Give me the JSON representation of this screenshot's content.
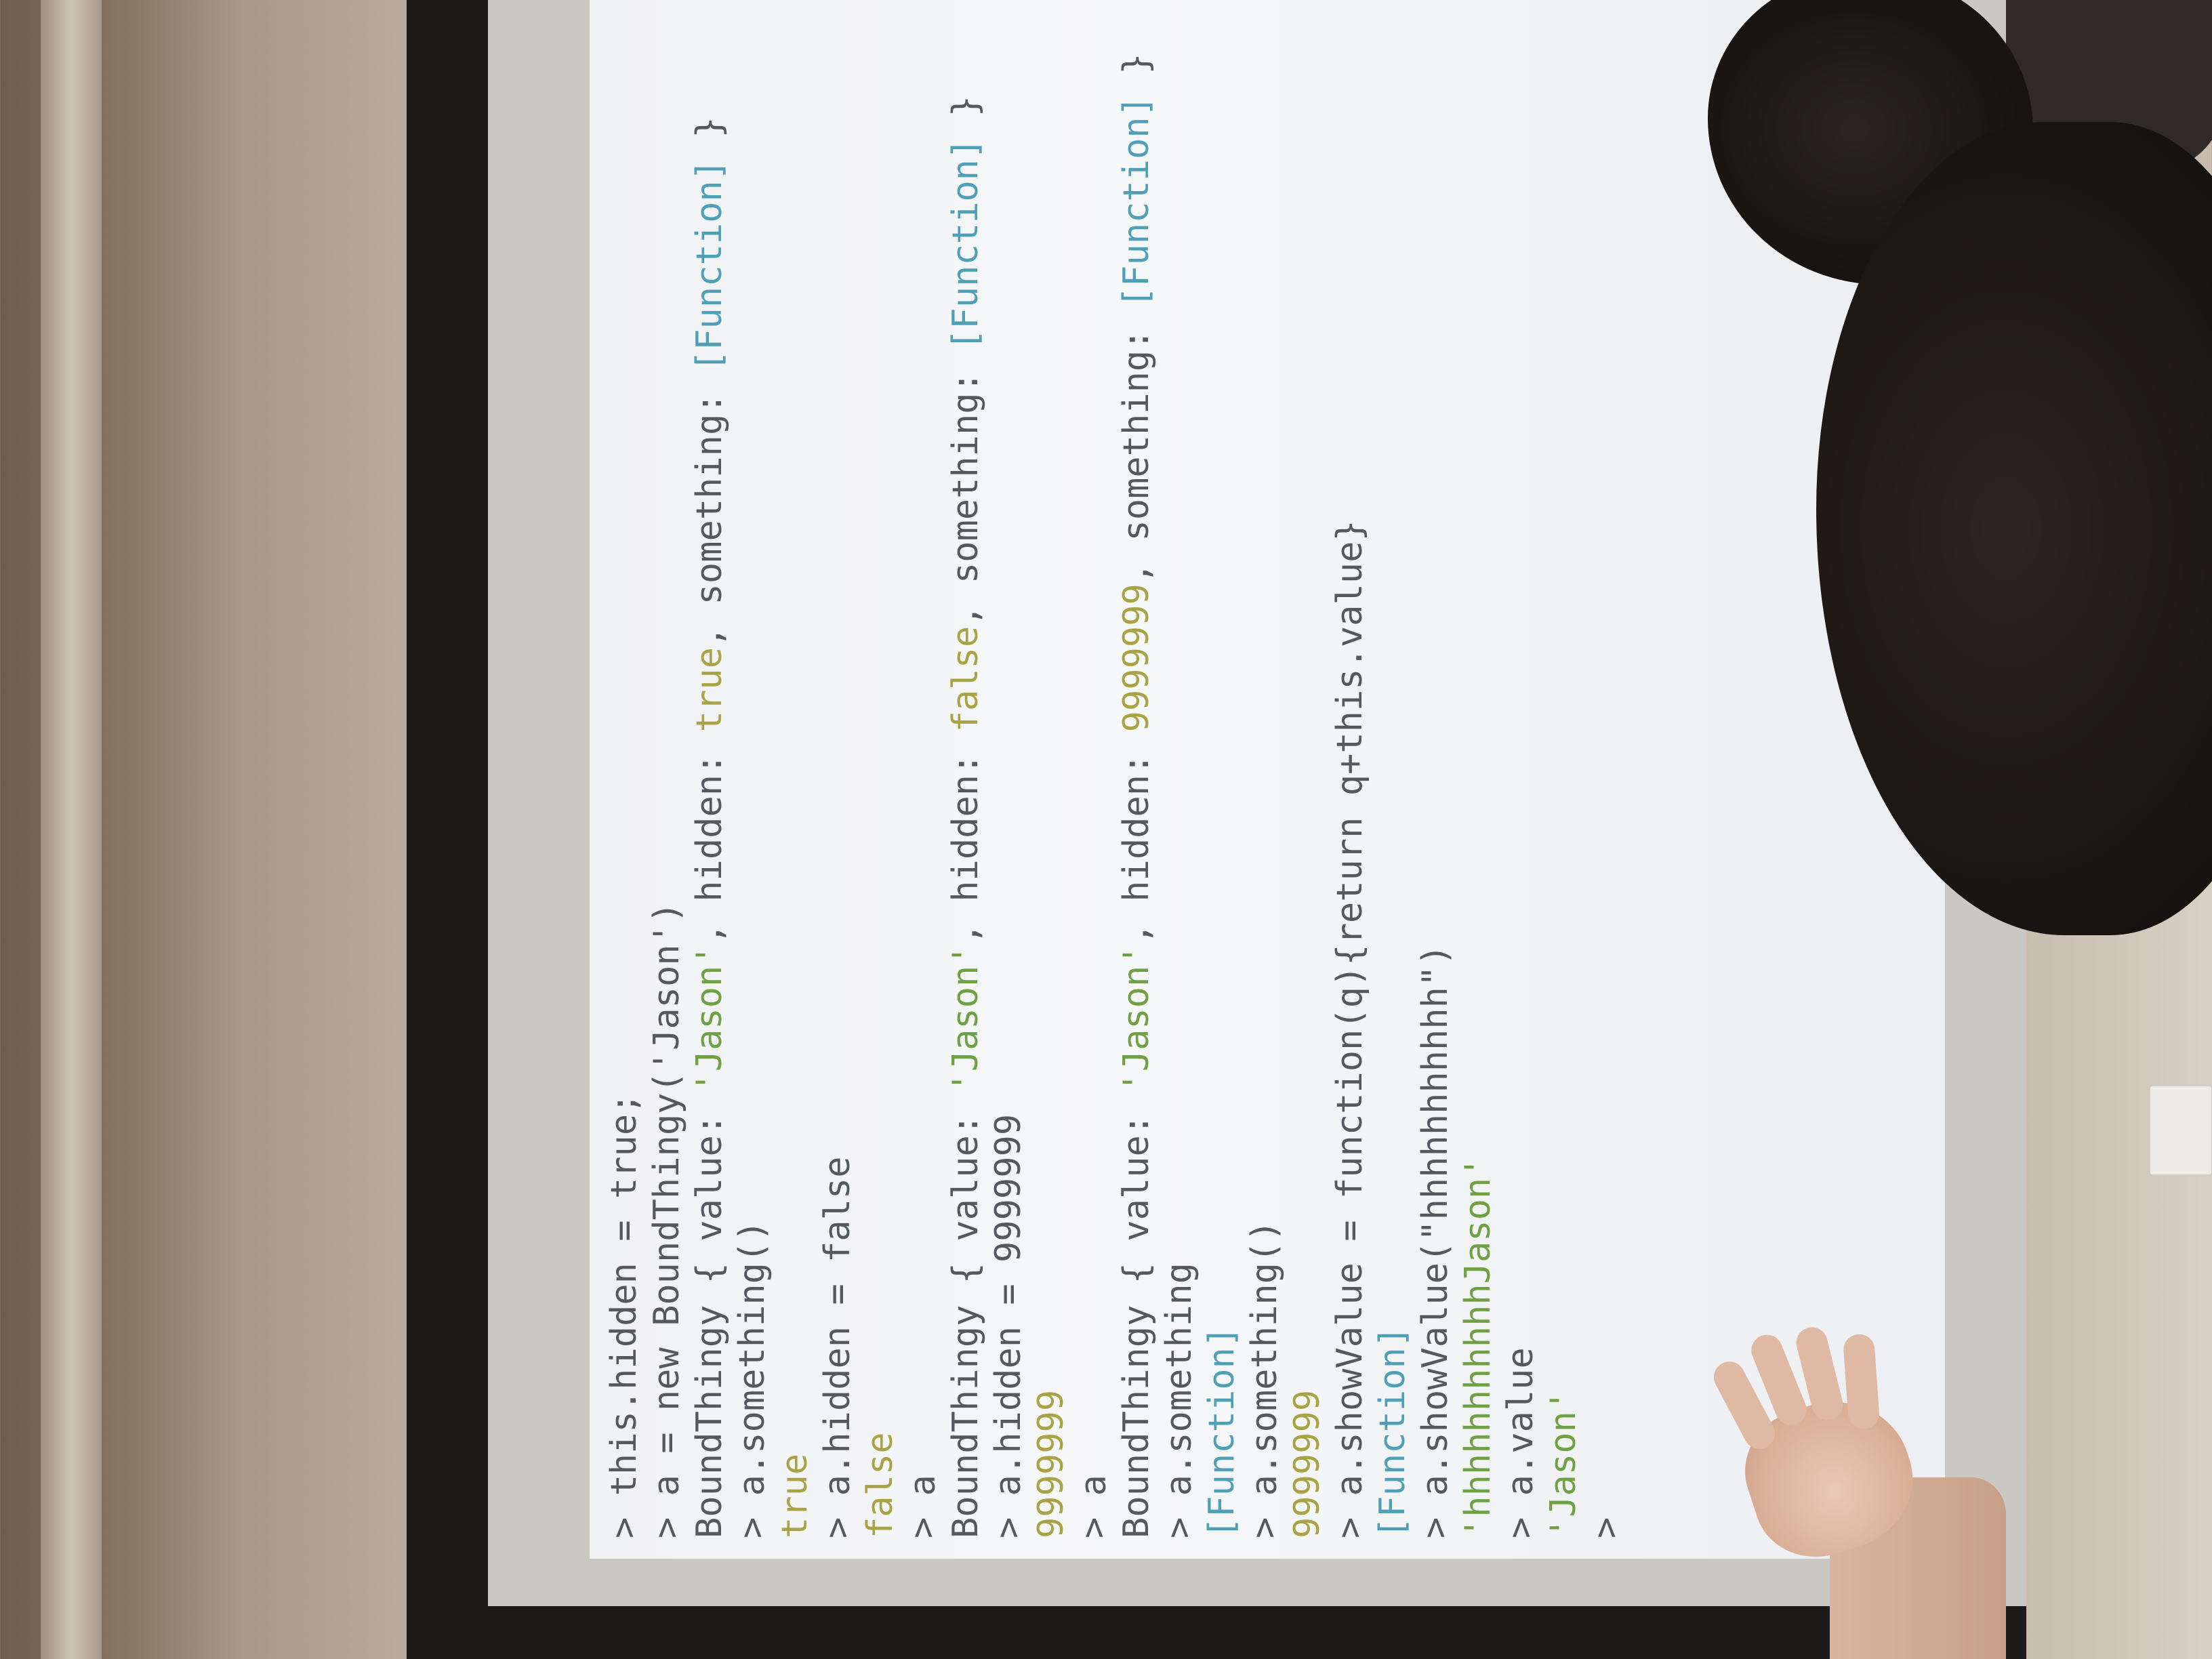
{
  "terminal": {
    "lines": [
      [
        {
          "t": "> this.hidden = true;",
          "c": "plain"
        }
      ],
      [
        {
          "t": "> a = new BoundThingy('Jason')",
          "c": "plain"
        }
      ],
      [
        {
          "t": "BoundThingy { value: ",
          "c": "plain"
        },
        {
          "t": "'Jason'",
          "c": "str"
        },
        {
          "t": ", hidden: ",
          "c": "plain"
        },
        {
          "t": "true",
          "c": "bool"
        },
        {
          "t": ", something: ",
          "c": "plain"
        },
        {
          "t": "[Function]",
          "c": "fn"
        },
        {
          "t": " }",
          "c": "plain"
        }
      ],
      [
        {
          "t": "> a.something()",
          "c": "plain"
        }
      ],
      [
        {
          "t": "true",
          "c": "bool"
        }
      ],
      [
        {
          "t": "> a.hidden = false",
          "c": "plain"
        }
      ],
      [
        {
          "t": "false",
          "c": "bool"
        }
      ],
      [
        {
          "t": "> a",
          "c": "plain"
        }
      ],
      [
        {
          "t": "BoundThingy { value: ",
          "c": "plain"
        },
        {
          "t": "'Jason'",
          "c": "str"
        },
        {
          "t": ", hidden: ",
          "c": "plain"
        },
        {
          "t": "false",
          "c": "bool"
        },
        {
          "t": ", something: ",
          "c": "plain"
        },
        {
          "t": "[Function]",
          "c": "fn"
        },
        {
          "t": " }",
          "c": "plain"
        }
      ],
      [
        {
          "t": "> a.hidden = 9999999",
          "c": "plain"
        }
      ],
      [
        {
          "t": "9999999",
          "c": "num"
        }
      ],
      [
        {
          "t": "> a",
          "c": "plain"
        }
      ],
      [
        {
          "t": "BoundThingy { value: ",
          "c": "plain"
        },
        {
          "t": "'Jason'",
          "c": "str"
        },
        {
          "t": ", hidden: ",
          "c": "plain"
        },
        {
          "t": "9999999",
          "c": "num"
        },
        {
          "t": ", something: ",
          "c": "plain"
        },
        {
          "t": "[Function]",
          "c": "fn"
        },
        {
          "t": " }",
          "c": "plain"
        }
      ],
      [
        {
          "t": "> a.something",
          "c": "plain"
        }
      ],
      [
        {
          "t": "[Function]",
          "c": "fn"
        }
      ],
      [
        {
          "t": "> a.something()",
          "c": "plain"
        }
      ],
      [
        {
          "t": "9999999",
          "c": "num"
        }
      ],
      [
        {
          "t": "> a.showValue = function(q){return q+this.value}",
          "c": "plain"
        }
      ],
      [
        {
          "t": "[Function]",
          "c": "fn"
        }
      ],
      [
        {
          "t": "> a.showValue(\"hhhhhhhhhhh\")",
          "c": "plain"
        }
      ],
      [
        {
          "t": "'hhhhhhhhhhhJason'",
          "c": "str"
        }
      ],
      [
        {
          "t": "> a.value",
          "c": "plain"
        }
      ],
      [
        {
          "t": "'Jason'",
          "c": "str"
        }
      ],
      [
        {
          "t": "> ",
          "c": "plain"
        }
      ]
    ]
  },
  "colors": {
    "plain": "#55595e",
    "string": "#6fa044",
    "boolean": "#a8a446",
    "function": "#4f9fb6",
    "screen": "#f3f4f6"
  }
}
